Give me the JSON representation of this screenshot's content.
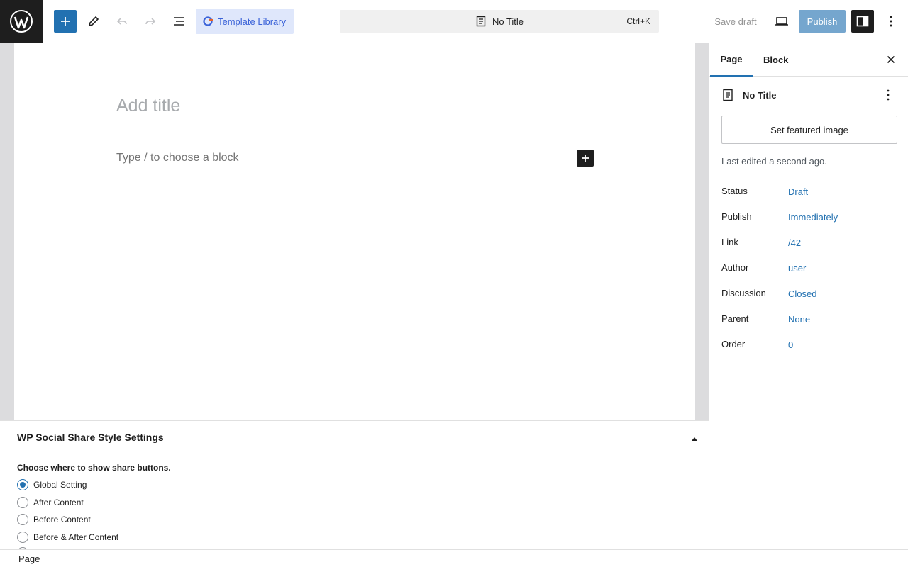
{
  "toolbar": {
    "template_library": "Template Library",
    "document_title": "No Title",
    "shortcut": "Ctrl+K",
    "save_draft": "Save draft",
    "publish": "Publish"
  },
  "editor": {
    "title_placeholder": "Add title",
    "block_placeholder": "Type / to choose a block"
  },
  "metabox": {
    "title": "WP Social Share Style Settings",
    "question": "Choose where to show share buttons.",
    "options": [
      {
        "label": "Global Setting",
        "selected": true
      },
      {
        "label": "After Content",
        "selected": false
      },
      {
        "label": "Before Content",
        "selected": false
      },
      {
        "label": "Before & After Content",
        "selected": false
      }
    ]
  },
  "sidebar": {
    "tabs": [
      "Page",
      "Block"
    ],
    "doc_title": "No Title",
    "featured_image": "Set featured image",
    "last_edited": "Last edited a second ago.",
    "properties": [
      {
        "label": "Status",
        "value": "Draft"
      },
      {
        "label": "Publish",
        "value": "Immediately"
      },
      {
        "label": "Link",
        "value": "/42"
      },
      {
        "label": "Author",
        "value": "user"
      },
      {
        "label": "Discussion",
        "value": "Closed"
      },
      {
        "label": "Parent",
        "value": "None"
      },
      {
        "label": "Order",
        "value": "0"
      }
    ]
  },
  "footer": {
    "breadcrumb": "Page"
  },
  "colors": {
    "accent": "#2271b1",
    "dark": "#1e1e1e",
    "template_library_bg": "#dfe7fb"
  }
}
